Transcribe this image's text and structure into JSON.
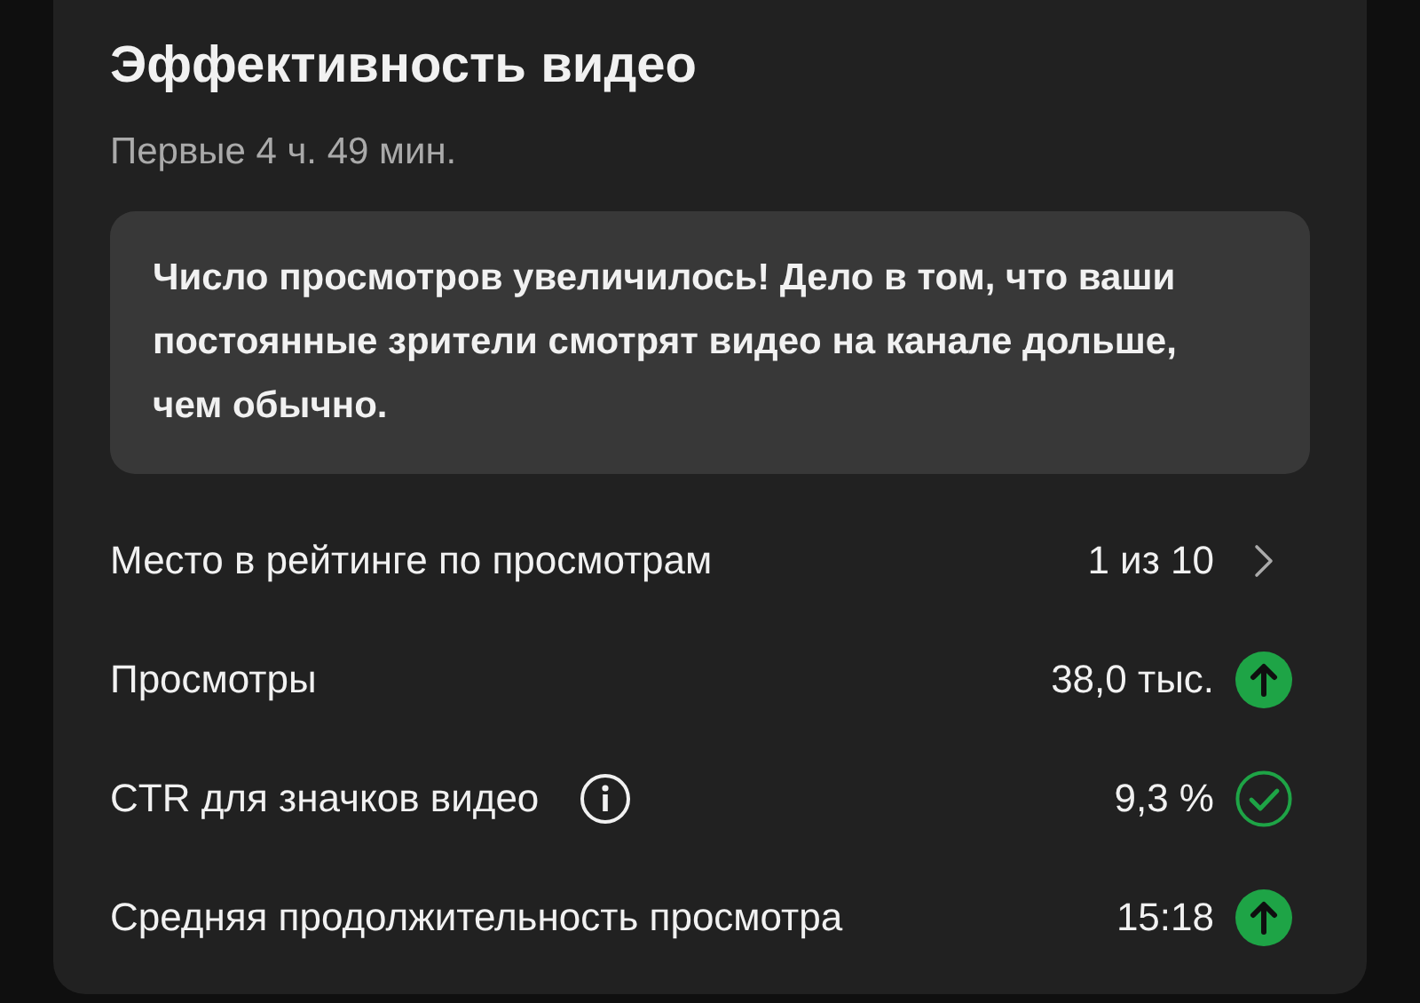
{
  "title": "Эффективность видео",
  "subtitle": "Первые 4 ч. 49 мин.",
  "insight": "Число просмотров увеличилось! Дело в том, что ваши постоянные зрители смотрят видео на канале дольше, чем обычно.",
  "metrics": [
    {
      "label": "Место в рейтинге по просмотрам",
      "value": "1 из 10",
      "info": false,
      "kind": "chevron"
    },
    {
      "label": "Просмотры",
      "value": "38,0 тыс.",
      "info": false,
      "kind": "up"
    },
    {
      "label": "CTR для значков видео",
      "value": "9,3 %",
      "info": true,
      "kind": "check"
    },
    {
      "label": "Средняя продолжительность просмотра",
      "value": "15:18",
      "info": false,
      "kind": "up"
    }
  ]
}
